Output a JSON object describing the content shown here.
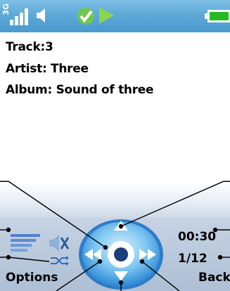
{
  "status": {
    "network_label": "3G",
    "colors": {
      "bar": "#5ea9d8",
      "battery": "#22bb22",
      "signal": "#ffffff"
    }
  },
  "track_info": {
    "track": "Track:3",
    "artist": "Artist: Three",
    "album": "Album: Sound of three"
  },
  "player": {
    "elapsed": "00:30",
    "position": "1/12"
  },
  "softkeys": {
    "left": "Options",
    "right": "Back"
  }
}
